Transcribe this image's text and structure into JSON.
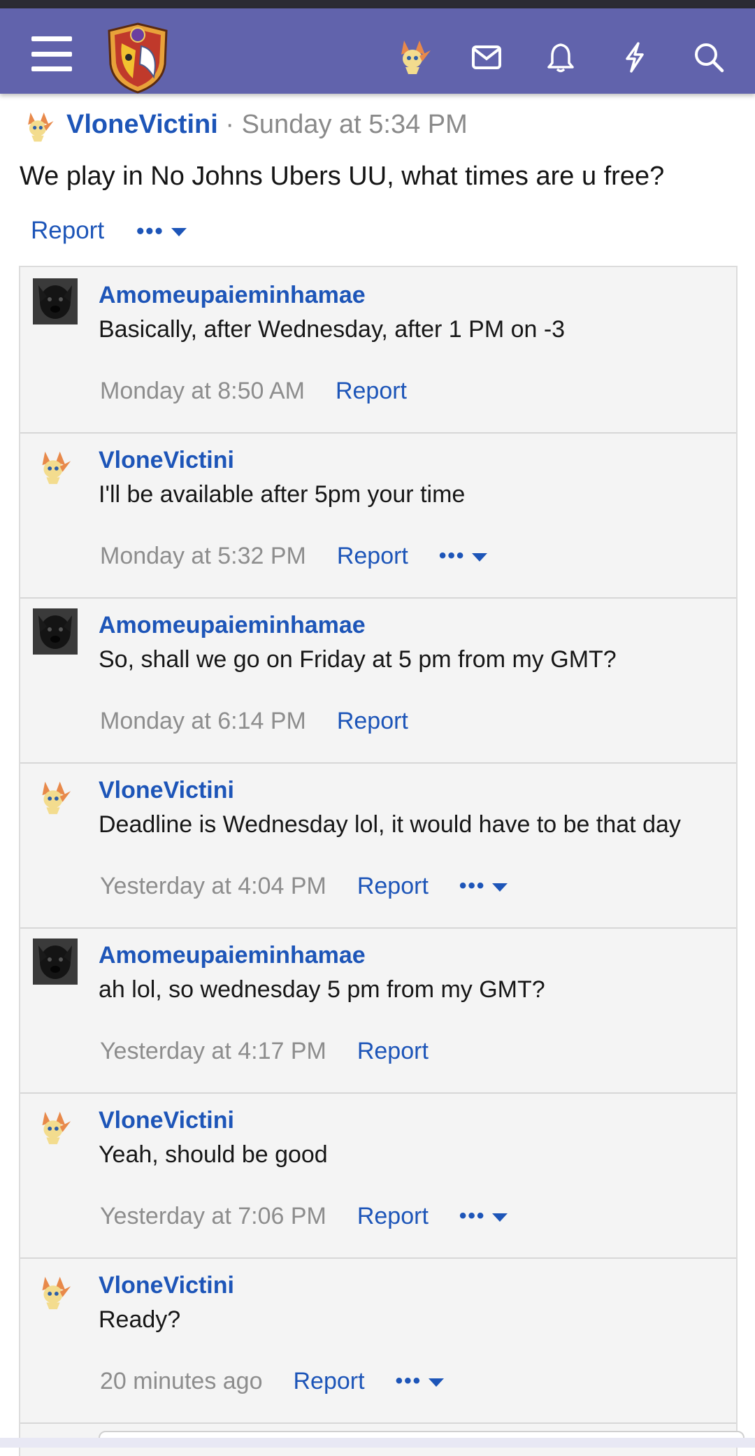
{
  "colors": {
    "navbar": "#6163ac",
    "link": "#1d55b8",
    "muted": "#8a8a8a",
    "panel": "#f4f4f4"
  },
  "navbar": {
    "menu_icon": "hamburger-menu-icon",
    "logo": "site-shield-logo",
    "icons": [
      "user-avatar-icon",
      "envelope-icon",
      "bell-icon",
      "lightning-bolt-icon",
      "search-icon"
    ]
  },
  "post": {
    "author": "VloneVictini",
    "separator": "·",
    "time": "Sunday at 5:34 PM",
    "body": "We play in No Johns Ubers UU, what times are u free?",
    "report_label": "Report",
    "more_label": "•••"
  },
  "comments": [
    {
      "author": "Amomeupaieminhamae",
      "avatar": "dog",
      "text": "Basically, after Wednesday, after 1 PM on -3",
      "time": "Monday at 8:50 AM",
      "report": "Report",
      "more": ""
    },
    {
      "author": "VloneVictini",
      "avatar": "victini",
      "text": "I'll be available after 5pm your time",
      "time": "Monday at 5:32 PM",
      "report": "Report",
      "more": "•••"
    },
    {
      "author": "Amomeupaieminhamae",
      "avatar": "dog",
      "text": "So, shall we go on Friday at 5 pm from my GMT?",
      "time": "Monday at 6:14 PM",
      "report": "Report",
      "more": ""
    },
    {
      "author": "VloneVictini",
      "avatar": "victini",
      "text": "Deadline is Wednesday lol, it would have to be that day",
      "time": "Yesterday at 4:04 PM",
      "report": "Report",
      "more": "•••"
    },
    {
      "author": "Amomeupaieminhamae",
      "avatar": "dog",
      "text": "ah lol, so wednesday 5 pm from my GMT?",
      "time": "Yesterday at 4:17 PM",
      "report": "Report",
      "more": ""
    },
    {
      "author": "VloneVictini",
      "avatar": "victini",
      "text": "Yeah, should be good",
      "time": "Yesterday at 7:06 PM",
      "report": "Report",
      "more": "•••"
    },
    {
      "author": "VloneVictini",
      "avatar": "victini",
      "text": "Ready?",
      "time": "20 minutes ago",
      "report": "Report",
      "more": "•••"
    }
  ]
}
